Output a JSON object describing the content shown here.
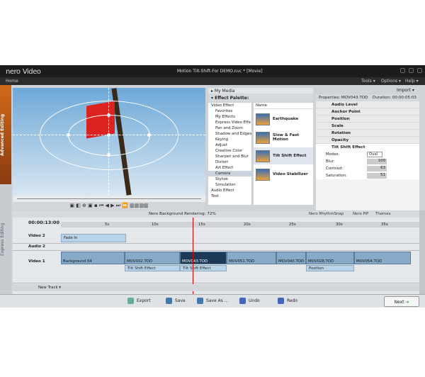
{
  "app": {
    "logo": "nero",
    "product": "Video",
    "window_title": "Motion Tilt-Shift-For DEMO.nvc * [Movie]"
  },
  "menu": {
    "home": "Home",
    "tools": "Tools ▾",
    "options": "Options ▾",
    "help": "Help ▾"
  },
  "sidetabs": {
    "advanced": "Advanced Editing",
    "express": "Express Editing"
  },
  "media": {
    "my_media": "My Media",
    "import": "Import ▾"
  },
  "palette": {
    "title": "Effect Palette:",
    "categories": [
      "Video Effect",
      "Favorites",
      "My Effects",
      "Express Video Effe",
      "Pan and Zoom",
      "Shadow and Edges",
      "Keying",
      "Adjust",
      "Creative Color",
      "Sharpen and Blur",
      "Distort",
      "Art Effect",
      "Camera",
      "Stylize",
      "Simulation",
      "Audio Effect",
      "Text"
    ],
    "name_header": "Name",
    "effects": [
      "Earthquake",
      "Slow & Fast Motion",
      "Tilt Shift Effect",
      "Video Stabilizer"
    ]
  },
  "properties": {
    "title": "Properties: MOV043.TOD",
    "duration": "Duration: 00:00:05:03",
    "groups": [
      "Audio Level",
      "Anchor Point",
      "Position",
      "Scale",
      "Rotation",
      "Opacity"
    ],
    "effect_name": "Tilt Shift Effect",
    "fields": [
      {
        "label": "Modes:",
        "value": "Oval"
      },
      {
        "label": "Blur:",
        "value": "100"
      },
      {
        "label": "Contrast:",
        "value": "63"
      },
      {
        "label": "Saturation:",
        "value": "51"
      }
    ]
  },
  "status": {
    "rendering": "Nero Background Rendering: 72%",
    "rhythm": "Nero RhythmSnap",
    "pip": "Nero PiP",
    "themes": "Themes"
  },
  "timeline": {
    "time": "00:00:13:00",
    "ticks": [
      "5s",
      "10s",
      "15s",
      "20s",
      "25s",
      "30s",
      "35s"
    ],
    "tracks": [
      "Video 2",
      "Audio 2",
      "Video 1"
    ],
    "video2_clip": "Fade In",
    "video1_clips": [
      "Background 04",
      "MOV032.TOD",
      "MOV043.TOD",
      "MOV051.TOD",
      "MOV040.TOD",
      "MOV028.TOD",
      "MOV054.TOD"
    ],
    "effect_labels": [
      "Tilt Shift Effect",
      "Tilt Shift Effect",
      "Position"
    ],
    "new_track": "New Track ▾"
  },
  "footer": {
    "export": "Export",
    "save": "Save",
    "save_as": "Save As ...",
    "undo": "Undo",
    "redo": "Redo",
    "next": "Next"
  },
  "colors": {
    "accent": "#d16a1a",
    "titlebar": "#1c1c1c",
    "clip": "#86aac8",
    "selected_clip": "#1c3a58",
    "playhead": "#cc0000"
  }
}
